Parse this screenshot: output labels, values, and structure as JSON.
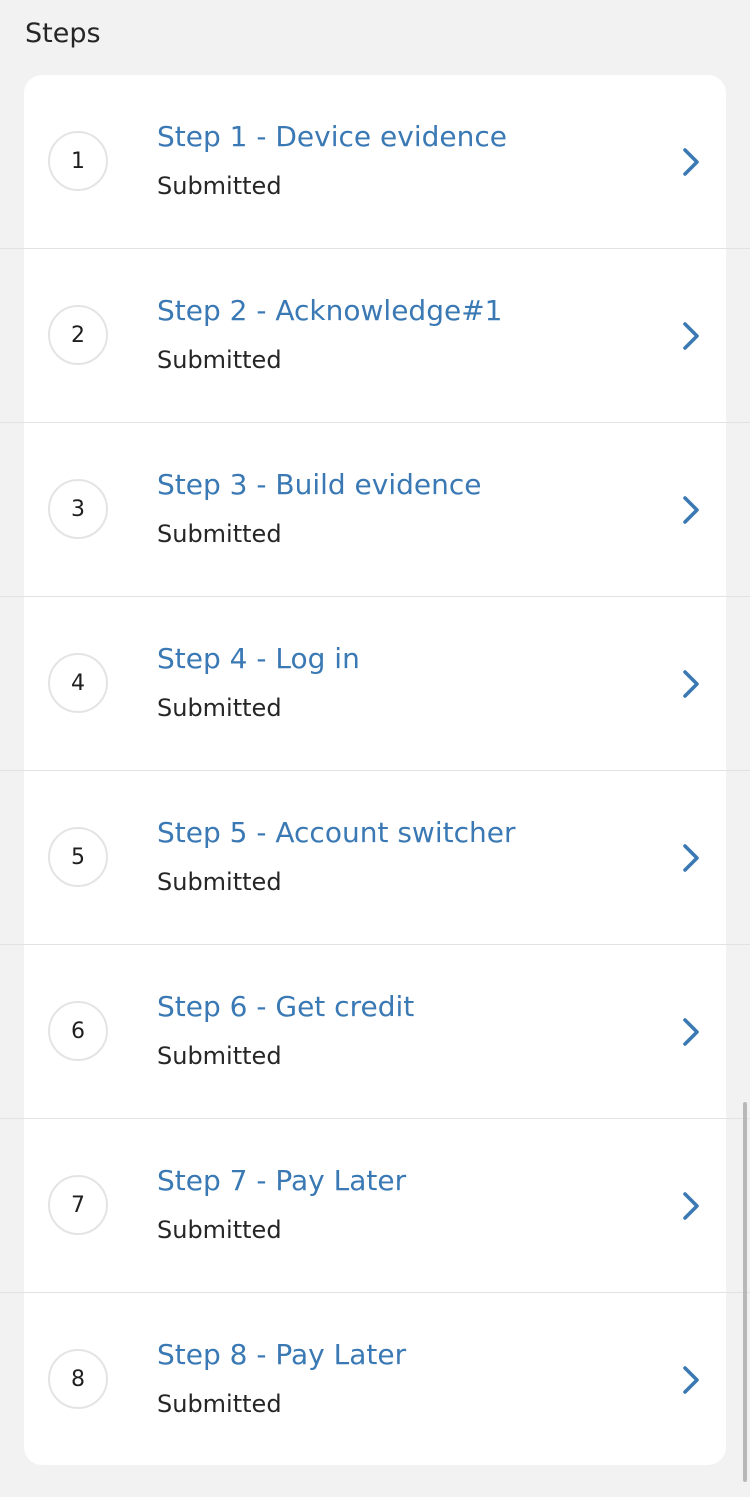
{
  "section": {
    "title": "Steps"
  },
  "steps": [
    {
      "number": "1",
      "title": "Step 1 - Device evidence",
      "status": "Submitted"
    },
    {
      "number": "2",
      "title": "Step 2 - Acknowledge#1",
      "status": "Submitted"
    },
    {
      "number": "3",
      "title": "Step 3 - Build evidence",
      "status": "Submitted"
    },
    {
      "number": "4",
      "title": "Step 4 - Log in",
      "status": "Submitted"
    },
    {
      "number": "5",
      "title": "Step 5 - Account switcher",
      "status": "Submitted"
    },
    {
      "number": "6",
      "title": "Step 6 - Get credit",
      "status": "Submitted"
    },
    {
      "number": "7",
      "title": "Step 7 - Pay Later",
      "status": "Submitted"
    },
    {
      "number": "8",
      "title": "Step 8 - Pay Later",
      "status": "Submitted"
    }
  ],
  "icons": {
    "row_action": "chevron-right-icon"
  },
  "colors": {
    "accent": "#3a79b4",
    "background": "#f2f2f2",
    "card": "#ffffff",
    "text": "#262626",
    "divider": "#e2e2e2"
  }
}
